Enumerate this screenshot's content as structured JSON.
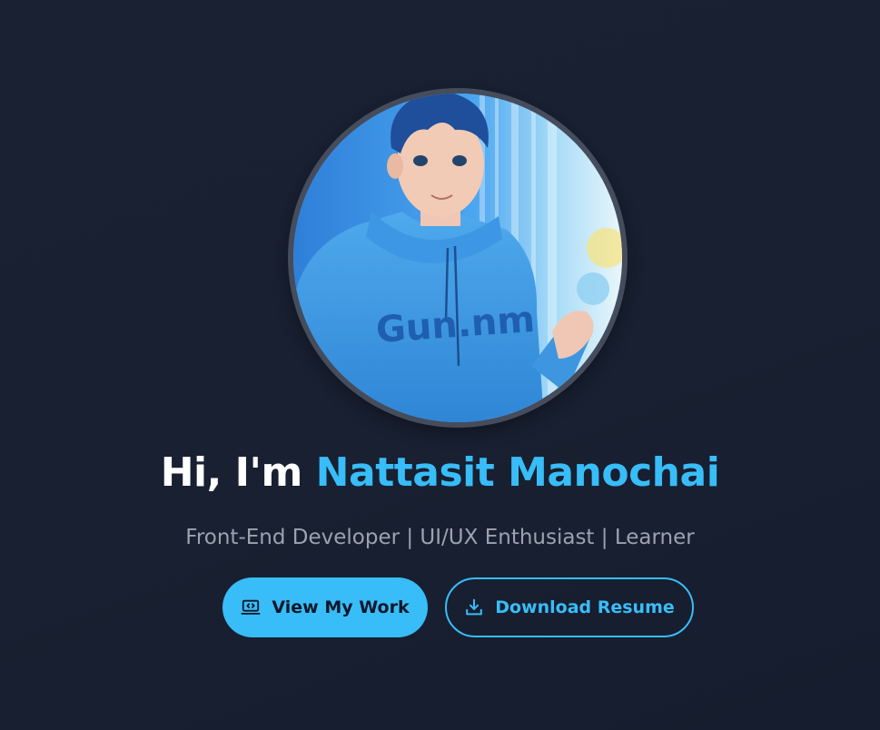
{
  "hero": {
    "greeting": "Hi, I'm",
    "name": "Nattasit Manochai",
    "subtitle": "Front-End Developer | UI/UX Enthusiast | Learner",
    "avatar_hoodie_text": "Gun.nm"
  },
  "actions": {
    "view_work_label": "View My Work",
    "view_work_icon": "laptop-code-icon",
    "download_resume_label": "Download Resume",
    "download_resume_icon": "download-icon"
  },
  "colors": {
    "background": "#182031",
    "accent": "#38bdf8",
    "heading": "#ffffff",
    "subtitle": "#9ca3af",
    "avatar_ring": "#454c5b"
  }
}
